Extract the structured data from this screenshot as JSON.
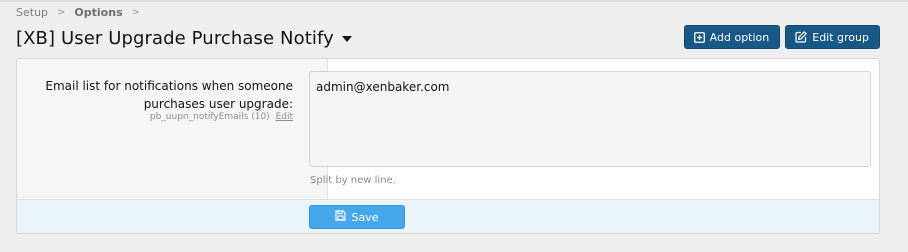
{
  "breadcrumb": [
    "Setup",
    "Options"
  ],
  "header": {
    "title": "[XB] User Upgrade Purchase Notify",
    "add_option_label": "Add option",
    "edit_group_label": "Edit group"
  },
  "option": {
    "label": "Email list for notifications when someone purchases user upgrade:",
    "hint_id": "pb_uupn_notifyEmails (10)",
    "hint_edit": "Edit",
    "value": "admin@xenbaker.com",
    "explain": "Split by new line."
  },
  "footer": {
    "save_label": "Save"
  },
  "colors": {
    "primary": "#185886",
    "save": "#47a7eb",
    "footer_bg": "#eaf4fb"
  },
  "icons": [
    "chevron-right-icon",
    "dropdown-caret-icon",
    "plus-square-icon",
    "edit-icon",
    "save-icon"
  ]
}
